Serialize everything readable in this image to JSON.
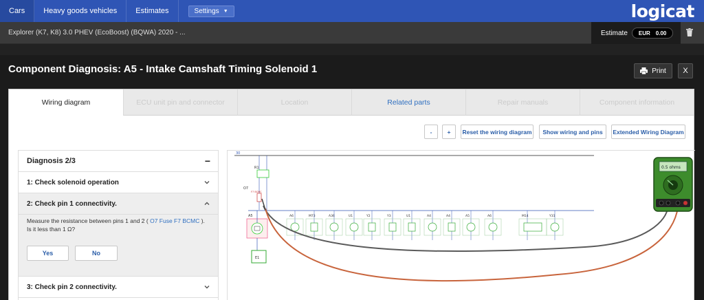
{
  "topbar": {
    "tabs": [
      {
        "label": "Cars"
      },
      {
        "label": "Heavy goods vehicles"
      },
      {
        "label": "Estimates"
      }
    ],
    "settings_label": "Settings",
    "logo": "logicat"
  },
  "vehicle": {
    "title": "Explorer (K7, K8) 3.0 PHEV (EcoBoost) (BQWA) 2020 - ...",
    "estimate_label": "Estimate",
    "currency": "EUR",
    "amount": "0.00"
  },
  "dialog": {
    "title": "Component Diagnosis: A5 - Intake Camshaft Timing Solenoid 1",
    "print_label": "Print",
    "close_label": "X",
    "tabs": [
      {
        "label": "Wiring diagram"
      },
      {
        "label": "ECU unit pin and connector"
      },
      {
        "label": "Location"
      },
      {
        "label": "Related parts"
      },
      {
        "label": "Repair manuals"
      },
      {
        "label": "Component information"
      }
    ]
  },
  "controls": {
    "zoom_out": "-",
    "zoom_in": "+",
    "reset": "Reset the wiring diagram",
    "show": "Show wiring and pins",
    "extended": "Extended Wiring Diagram"
  },
  "diagnosis": {
    "title": "Diagnosis 2/3",
    "collapse": "−",
    "steps": [
      {
        "label": "1: Check solenoid operation"
      },
      {
        "label": "2: Check pin 1 connectivity."
      },
      {
        "label": "3: Check pin 2 connectivity."
      }
    ],
    "question_pre": "Measure the resistance between pins 1 and 2 ( ",
    "question_link": "O7 Fuse F7 BCMC",
    "question_post": " ). Is it less than 1 Ω?",
    "yes": "Yes",
    "no": "No"
  },
  "diagram": {
    "bus_label": "30",
    "fuse_label": "O7",
    "fuse_sub": "F7 BCMC",
    "relay_label": "R1",
    "main_label": "A5",
    "ground_label": "E1",
    "components": [
      "A5",
      "A6",
      "M73",
      "A36",
      "U1",
      "Y2",
      "Y3",
      "U1",
      "A4",
      "A4",
      "A5",
      "A6",
      "M14",
      "Y31"
    ],
    "meter_reading": "0.5 ohms"
  },
  "colors": {
    "accent": "#2f55b5",
    "probe_red": "#c8643c",
    "probe_black": "#5a5a5a",
    "meter_green": "#3d8c2c"
  }
}
